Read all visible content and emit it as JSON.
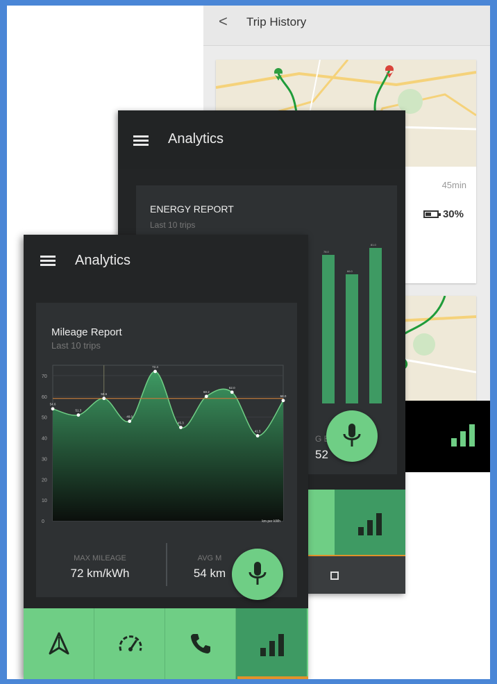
{
  "trip_history": {
    "back_icon": "chevron-left-icon",
    "back_glyph": "<",
    "title": "Trip History",
    "duration": "45min",
    "battery": "30%"
  },
  "energy_screen": {
    "title": "Analytics",
    "card_title": "ENERGY REPORT",
    "card_subtitle": "Last 10 trips",
    "partial_text": "G E",
    "partial_value": "52"
  },
  "mileage_screen": {
    "title": "Analytics",
    "card_title": "Mileage Report",
    "card_subtitle": "Last 10 trips",
    "unit_label": "km per kWh",
    "stats": {
      "max_label": "MAX MILEAGE",
      "max_value": "72 km/kWh",
      "avg_label": "AVG M",
      "avg_value": "54 km"
    }
  },
  "chart_data": [
    {
      "type": "area",
      "title": "Mileage Report",
      "subtitle": "Last 10 trips",
      "xlabel": "",
      "ylabel": "km per kWh",
      "ylim": [
        0,
        75
      ],
      "yticks": [
        0,
        10,
        20,
        30,
        40,
        50,
        60,
        70
      ],
      "x": [
        1,
        2,
        3,
        4,
        5,
        6,
        7,
        8,
        9,
        10
      ],
      "values": [
        54,
        51,
        59,
        48,
        72,
        45,
        60,
        62,
        41,
        58
      ],
      "point_labels": [
        "54.6",
        "51.3",
        "59.6",
        "48.0",
        "72.4",
        "45.3",
        "60.2",
        "62.0",
        "41.5",
        "58.0"
      ],
      "reference_line": 59,
      "grid": true,
      "colors": {
        "fill_top": "#3e9a63",
        "fill_bottom": "#0b0f0c",
        "line": "#6fce85",
        "reference": "#c07a3c"
      }
    },
    {
      "type": "bar",
      "title": "ENERGY REPORT",
      "subtitle": "Last 10 trips",
      "ylim": [
        0,
        100
      ],
      "values": [
        78.0,
        66.0,
        81.0
      ],
      "value_labels": [
        "78.0",
        "66.0",
        "81.0"
      ],
      "colors": {
        "bar": "#3e9a63"
      }
    }
  ],
  "nav_icons": [
    "navigation-arrow-icon",
    "speedometer-icon",
    "phone-icon",
    "bar-chart-icon"
  ],
  "colors": {
    "accent_green": "#6fce85",
    "active_green": "#3e9a63",
    "dark_bg": "#232526",
    "card_bg": "#2e3133",
    "underline_orange": "#e0922b"
  }
}
